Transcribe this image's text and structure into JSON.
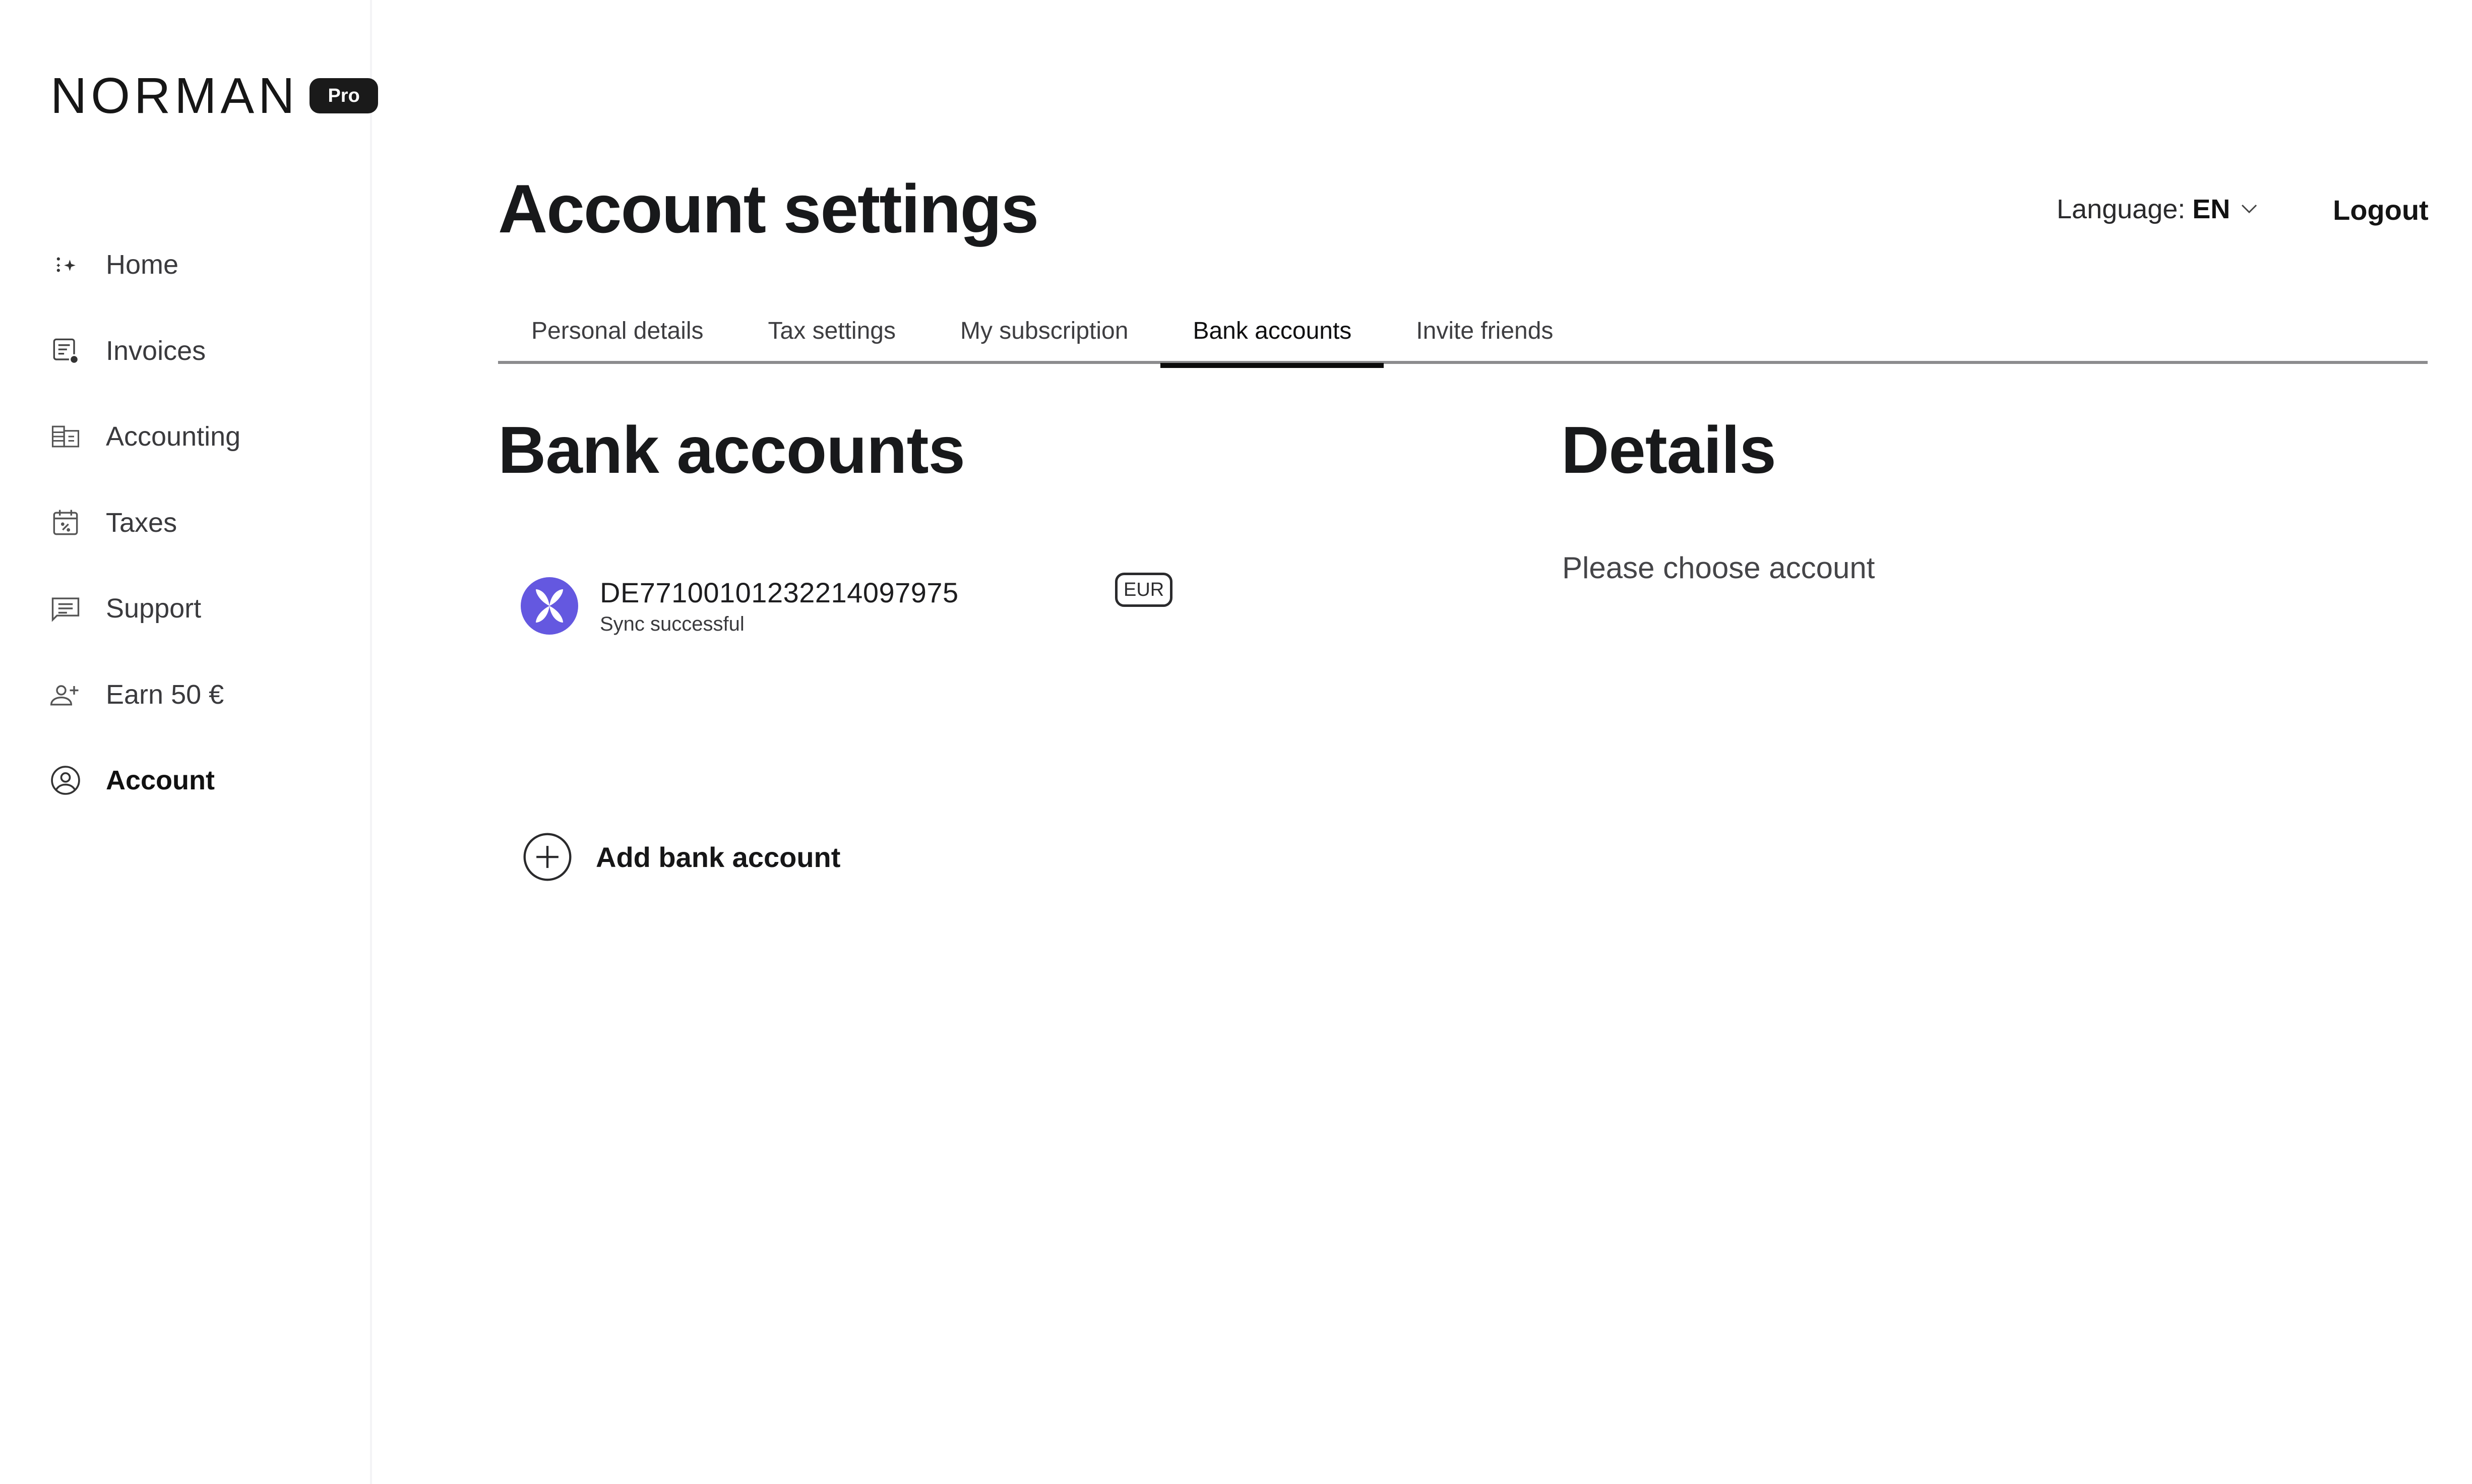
{
  "brand": {
    "name": "NORMAN",
    "badge": "Pro"
  },
  "sidebar": {
    "items": [
      {
        "label": "Home",
        "icon": "sparkles-icon",
        "active": false
      },
      {
        "label": "Invoices",
        "icon": "invoice-icon",
        "active": false
      },
      {
        "label": "Accounting",
        "icon": "accounting-icon",
        "active": false
      },
      {
        "label": "Taxes",
        "icon": "tax-calendar-icon",
        "active": false
      },
      {
        "label": "Support",
        "icon": "chat-icon",
        "active": false
      },
      {
        "label": "Earn 50 €",
        "icon": "add-user-icon",
        "active": false
      },
      {
        "label": "Account",
        "icon": "user-circle-icon",
        "active": true
      }
    ]
  },
  "header": {
    "title": "Account settings",
    "language_label": "Language:",
    "language_value": "EN",
    "logout_label": "Logout"
  },
  "tabs": [
    {
      "label": "Personal details",
      "active": false
    },
    {
      "label": "Tax settings",
      "active": false
    },
    {
      "label": "My subscription",
      "active": false
    },
    {
      "label": "Bank accounts",
      "active": true
    },
    {
      "label": "Invite friends",
      "active": false
    }
  ],
  "bank_accounts": {
    "title": "Bank accounts",
    "accounts": [
      {
        "number": "DE77100101232214097975",
        "status": "Sync successful",
        "currency": "EUR",
        "logo_color": "#6458e0"
      }
    ],
    "add_label": "Add bank account"
  },
  "details": {
    "title": "Details",
    "empty_message": "Please choose account"
  }
}
